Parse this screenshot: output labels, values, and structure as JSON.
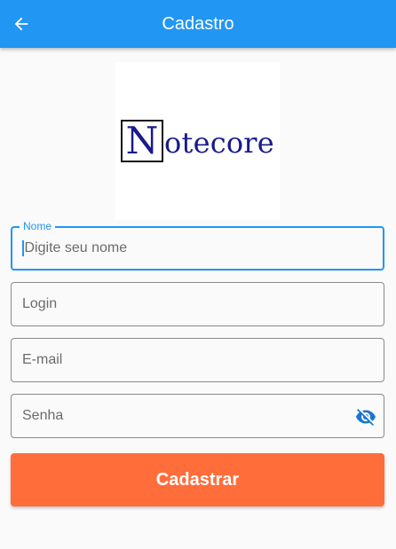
{
  "app_bar": {
    "title": "Cadastro",
    "back_icon": "arrow-back-icon",
    "background_color": "#2196f3"
  },
  "logo": {
    "text_first_letter": "N",
    "text_rest": "otecore",
    "color": "#1a1a8c"
  },
  "form": {
    "name_field": {
      "label": "Nome",
      "placeholder": "Digite seu nome",
      "value": ""
    },
    "login_field": {
      "placeholder": "Login",
      "value": ""
    },
    "email_field": {
      "placeholder": "E-mail",
      "value": ""
    },
    "password_field": {
      "placeholder": "Senha",
      "value": "",
      "visibility_icon": "visibility-off-icon"
    },
    "submit_label": "Cadastrar",
    "submit_color": "#ff6d3b",
    "focus_color": "#2196f3"
  }
}
